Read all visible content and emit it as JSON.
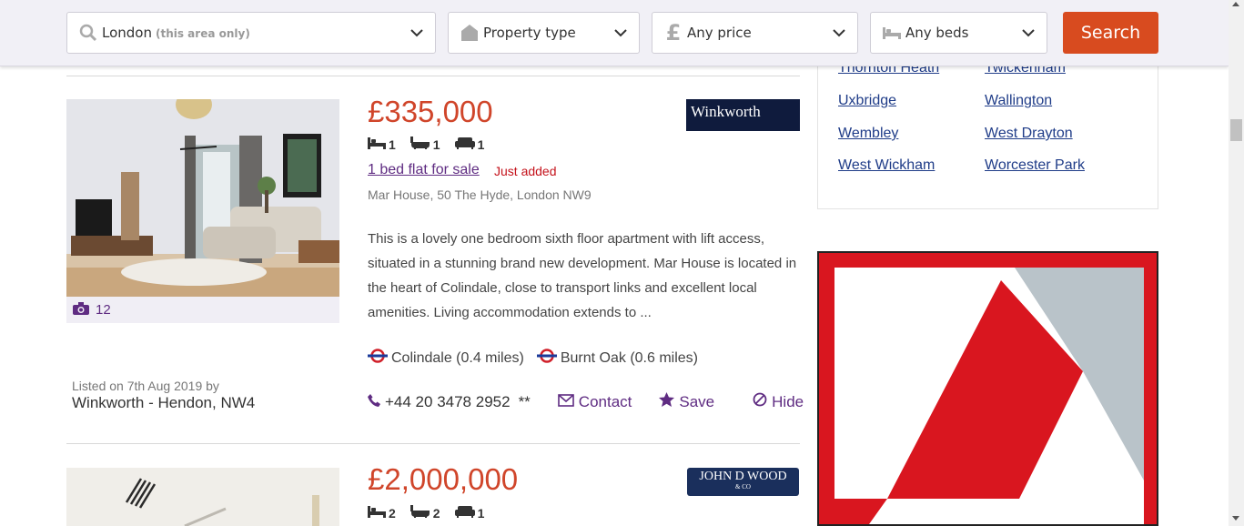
{
  "search": {
    "location_value": "London",
    "location_hint": "(this area only)",
    "property_type": "Property type",
    "price": "Any price",
    "beds": "Any beds",
    "button_label": "Search"
  },
  "listings": [
    {
      "price": "£335,000",
      "beds": "1",
      "baths": "1",
      "receptions": "1",
      "title": "1 bed flat for sale",
      "badge": "Just added",
      "address": "Mar House, 50 The Hyde, London NW9",
      "description": "This is a lovely one bedroom sixth floor apartment with lift access, situated in a stunning brand new development. Mar House is located in the heart of Colindale, close to transport links and excellent local amenities. Living accommodation extends to ...",
      "photo_count": "12",
      "stations": [
        "Colindale (0.4 miles)",
        "Burnt Oak (0.6 miles)"
      ],
      "listed_on": "Listed on 7th Aug 2019 by",
      "agent": "Winkworth - Hendon, NW4",
      "agent_logo_text": "Winkworth",
      "phone": "+44 20 3478 2952",
      "phone_suffix": "**",
      "contact_label": "Contact",
      "save_label": "Save",
      "hide_label": "Hide"
    },
    {
      "price": "£2,000,000",
      "beds": "2",
      "baths": "2",
      "receptions": "1",
      "agent_logo_text": "JOHN D WOOD",
      "agent_logo_sub": "& CO"
    }
  ],
  "areas": [
    "Thornton Heath",
    "Twickenham",
    "Uxbridge",
    "Wallington",
    "Wembley",
    "West Drayton",
    "West Wickham",
    "Worcester Park"
  ],
  "colors": {
    "accent_purple": "#5f2c82",
    "price_red": "#d0452a",
    "search_button": "#d84b1f",
    "link_blue": "#1f3c88"
  }
}
